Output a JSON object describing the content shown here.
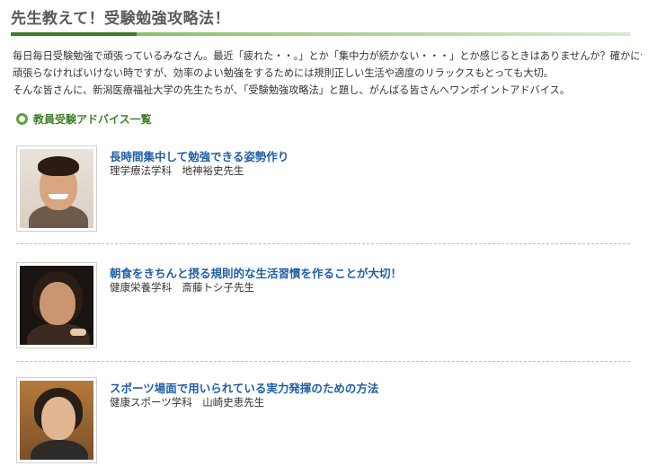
{
  "page": {
    "title": "先生教えて！受験勉強攻略法！"
  },
  "intro": {
    "lines": [
      "毎日毎日受験勉強で頑張っているみなさん。最近「疲れた・・。」とか「集中力が続かない・・・」とか感じるときはありませんか？確かに今は",
      "頑張らなければいけない時ですが、効率のよい勉強をするためには規則正しい生活や適度のリラックスもとっても大切。",
      "そんな皆さんに、新潟医療福祉大学の先生たちが、「受験勉強攻略法」と題し、がんばる皆さんへワンポイントアドバイス。"
    ]
  },
  "section": {
    "heading": "教員受験アドバイス一覧",
    "icon": "ring-bullet-icon"
  },
  "advice": [
    {
      "title": "長時間集中して勉強できる姿勢作り",
      "teacher": "理学療法学科　地神裕史先生"
    },
    {
      "title": "朝食をきちんと摂る規則的な生活習慣を作ることが大切！",
      "teacher": "健康栄養学科　斎藤トシ子先生"
    },
    {
      "title": "スポーツ場面で用いられている実力発揮のための方法",
      "teacher": "健康スポーツ学科　山崎史恵先生"
    }
  ],
  "colors": {
    "title_rule": "#3d7a2a",
    "heading_green": "#3f7f27",
    "link_blue": "#1f5fa6"
  }
}
